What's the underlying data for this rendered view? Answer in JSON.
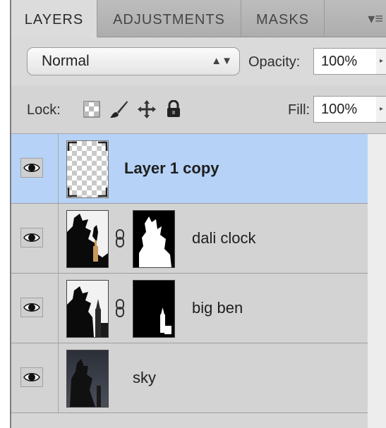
{
  "tabs": [
    {
      "label": "LAYERS",
      "active": true
    },
    {
      "label": "ADJUSTMENTS",
      "active": false
    },
    {
      "label": "MASKS",
      "active": false
    }
  ],
  "blend_mode": {
    "value": "Normal"
  },
  "opacity": {
    "label": "Opacity:",
    "value": "100%"
  },
  "lock": {
    "label": "Lock:",
    "icons": [
      "lock-transparent-pixels-icon",
      "lock-image-pixels-icon",
      "lock-position-icon",
      "lock-all-icon"
    ]
  },
  "fill": {
    "label": "Fill:",
    "value": "100%"
  },
  "layers": [
    {
      "name": "Layer 1 copy",
      "selected": true,
      "visible": true,
      "has_mask": false
    },
    {
      "name": "dali clock",
      "selected": false,
      "visible": true,
      "has_mask": true
    },
    {
      "name": "big ben",
      "selected": false,
      "visible": true,
      "has_mask": true
    },
    {
      "name": "sky",
      "selected": false,
      "visible": true,
      "has_mask": false
    }
  ],
  "colors": {
    "selection": "#b6d2f6",
    "panel": "#d3d3d3"
  }
}
